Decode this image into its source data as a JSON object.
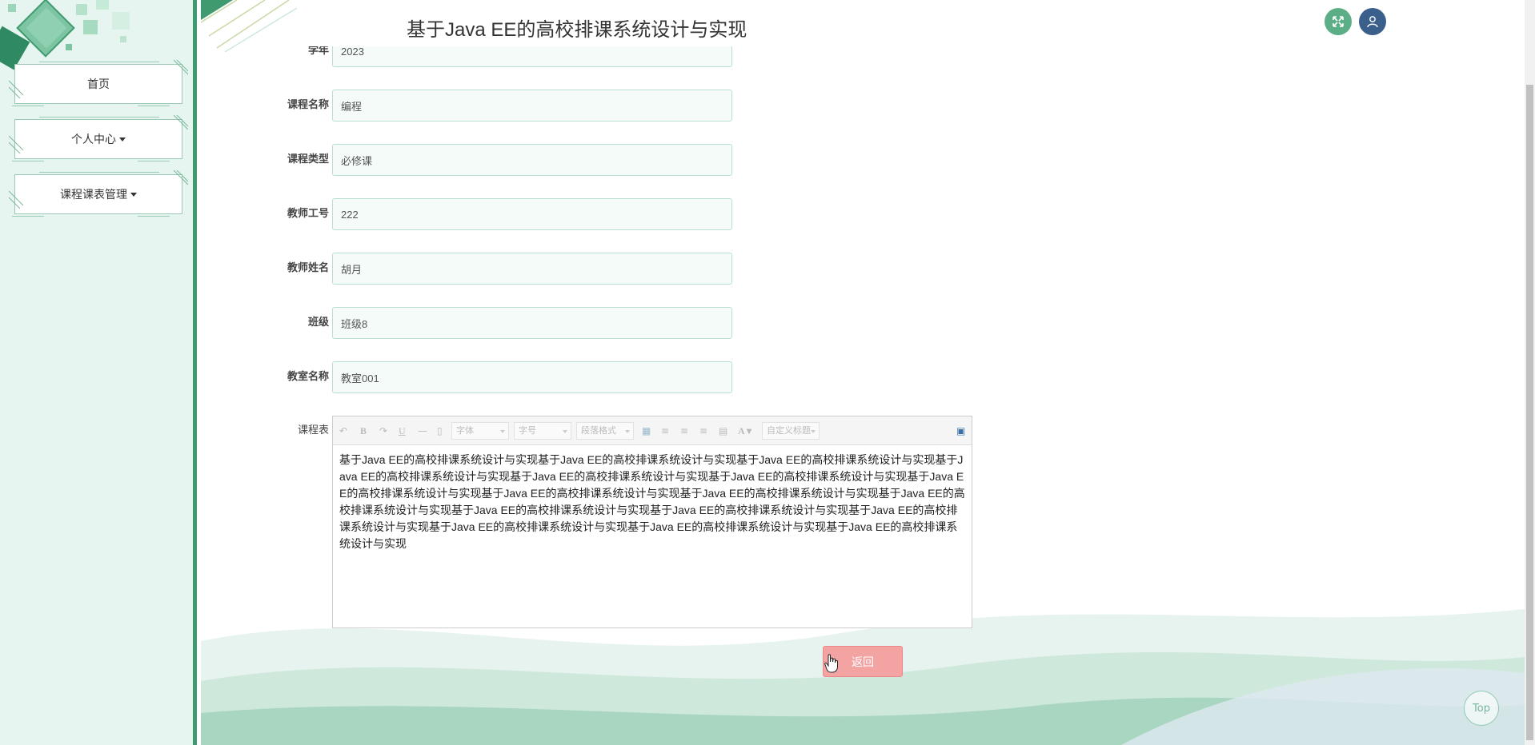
{
  "header": {
    "title": "基于Java EE的高校排课系统设计与实现",
    "fullscreen_icon": "expand-icon",
    "user_icon": "user-icon",
    "colors": {
      "fullscreen": "#5cae87",
      "user": "#3a5f8a"
    }
  },
  "sidebar": {
    "items": [
      {
        "label": "首页",
        "has_caret": false
      },
      {
        "label": "个人中心",
        "has_caret": true
      },
      {
        "label": "课程课表管理",
        "has_caret": true
      }
    ]
  },
  "form": {
    "fields": [
      {
        "label": "学年",
        "value": "2023"
      },
      {
        "label": "课程名称",
        "value": "编程"
      },
      {
        "label": "课程类型",
        "value": "必修课"
      },
      {
        "label": "教师工号",
        "value": "222"
      },
      {
        "label": "教师姓名",
        "value": "胡月"
      },
      {
        "label": "班级",
        "value": "班级8"
      },
      {
        "label": "教室名称",
        "value": "教室001"
      }
    ],
    "editor": {
      "label": "课程表",
      "toolbar": {
        "font_family": "字体",
        "font_size": "字号",
        "paragraph": "段落格式",
        "custom_title": "自定义标题"
      },
      "content": "基于Java EE的高校排课系统设计与实现基于Java EE的高校排课系统设计与实现基于Java EE的高校排课系统设计与实现基于Java EE的高校排课系统设计与实现基于Java EE的高校排课系统设计与实现基于Java EE的高校排课系统设计与实现基于Java EE的高校排课系统设计与实现基于Java EE的高校排课系统设计与实现基于Java EE的高校排课系统设计与实现基于Java EE的高校排课系统设计与实现基于Java EE的高校排课系统设计与实现基于Java EE的高校排课系统设计与实现基于Java EE的高校排课系统设计与实现基于Java EE的高校排课系统设计与实现基于Java EE的高校排课系统设计与实现基于Java EE的高校排课系统设计与实现"
    },
    "back_label": "返回"
  },
  "top_link": "Top",
  "colors": {
    "accent": "#3f9a6f",
    "sidebar_bg": "#e6f5ef",
    "back_button": "#f4a3a3",
    "input_border": "#b8e0cf"
  }
}
